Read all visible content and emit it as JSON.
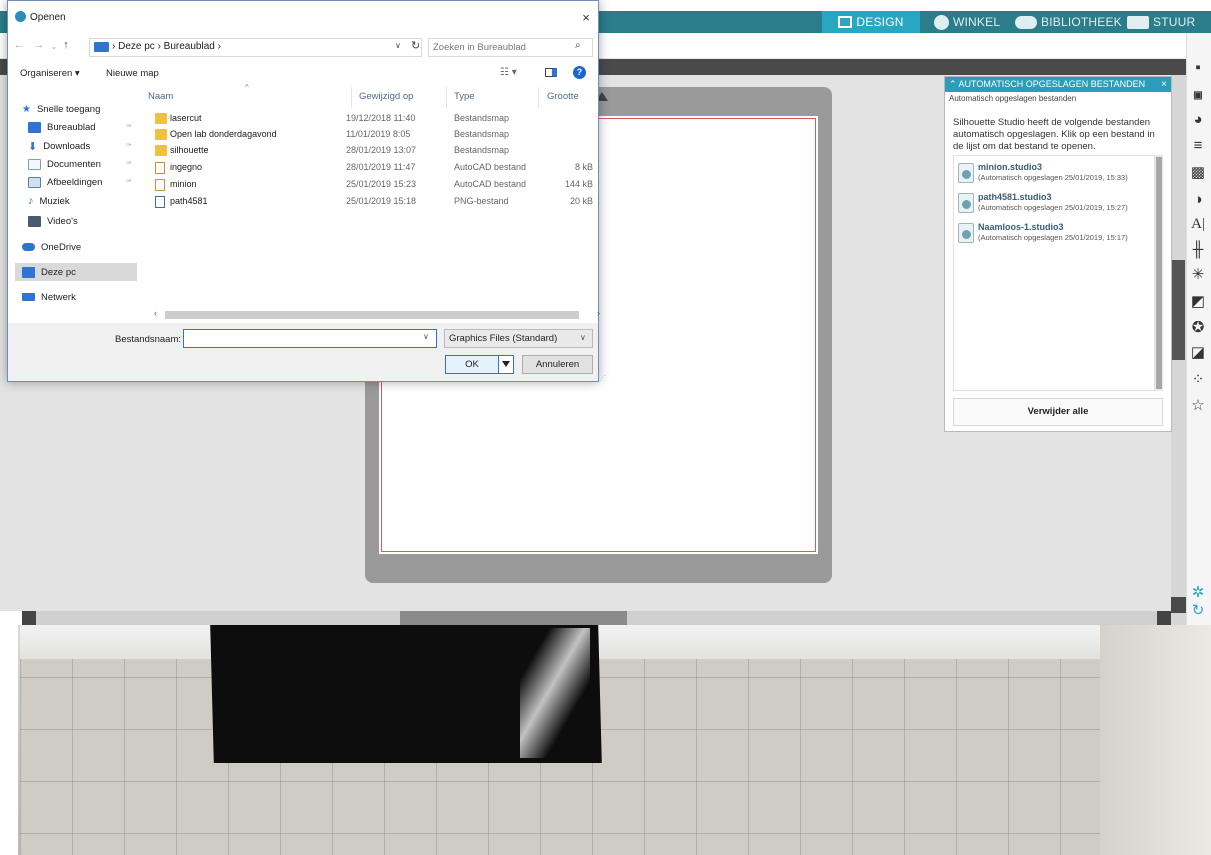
{
  "app": {
    "nav": [
      "DESIGN",
      "WINKEL",
      "BIBLIOTHEEK",
      "STUUR"
    ],
    "colors": {
      "topbar": "#2b7d8c",
      "active_tab": "#27a7c1",
      "cut_line": "#e25757"
    }
  },
  "autosave": {
    "header": "AUTOMATISCH OPGESLAGEN BESTANDEN",
    "close": "×",
    "subtitle": "Automatisch opgeslagen bestanden",
    "intro": "Silhouette Studio heeft de volgende bestanden automatisch opgeslagen. Klik op een bestand in de lijst om dat bestand te openen.",
    "files": [
      {
        "name": "minion.studio3",
        "meta": "(Automatisch opgeslagen 25/01/2019, 15:33)"
      },
      {
        "name": "path4581.studio3",
        "meta": "(Automatisch opgeslagen 25/01/2019, 15:27)"
      },
      {
        "name": "Naamloos-1.studio3",
        "meta": "(Automatisch opgeslagen 25/01/2019, 15:17)"
      }
    ],
    "delete_all": "Verwijder alle"
  },
  "dialog": {
    "title": "Openen",
    "close": "×",
    "breadcrumb": "› Deze pc › Bureaublad ›",
    "search_placeholder": "Zoeken in Bureaublad",
    "toolbar": {
      "organize": "Organiseren ▾",
      "new_folder": "Nieuwe map"
    },
    "nav_pane": [
      {
        "label": "Snelle toegang",
        "icon": "star-icon",
        "pinned": false
      },
      {
        "label": "Bureaublad",
        "icon": "desktop-icon",
        "pinned": true
      },
      {
        "label": "Downloads",
        "icon": "download-icon",
        "pinned": true
      },
      {
        "label": "Documenten",
        "icon": "documents-icon",
        "pinned": true
      },
      {
        "label": "Afbeeldingen",
        "icon": "pictures-icon",
        "pinned": true
      },
      {
        "label": "Muziek",
        "icon": "music-icon",
        "pinned": false
      },
      {
        "label": "Video's",
        "icon": "video-icon",
        "pinned": false
      },
      {
        "label": "OneDrive",
        "icon": "onedrive-icon",
        "pinned": false
      },
      {
        "label": "Deze pc",
        "icon": "this-pc-icon",
        "pinned": false,
        "selected": true
      },
      {
        "label": "Netwerk",
        "icon": "network-icon",
        "pinned": false
      }
    ],
    "columns": {
      "name": "Naam",
      "modified": "Gewijzigd op",
      "type": "Type",
      "size": "Grootte"
    },
    "files": [
      {
        "name": "lasercut",
        "modified": "19/12/2018 11:40",
        "type": "Bestandsmap",
        "size": "",
        "icon": "folder-icon"
      },
      {
        "name": "Open lab donderdagavond",
        "modified": "11/01/2019 8:05",
        "type": "Bestandsmap",
        "size": "",
        "icon": "folder-icon"
      },
      {
        "name": "silhouette",
        "modified": "28/01/2019 13:07",
        "type": "Bestandsmap",
        "size": "",
        "icon": "folder-icon"
      },
      {
        "name": "ingegno",
        "modified": "28/01/2019 11:47",
        "type": "AutoCAD bestand",
        "size": "8 kB",
        "icon": "autocad-file-icon"
      },
      {
        "name": "minion",
        "modified": "25/01/2019 15:23",
        "type": "AutoCAD bestand",
        "size": "144 kB",
        "icon": "autocad-file-icon"
      },
      {
        "name": "path4581",
        "modified": "25/01/2019 15:18",
        "type": "PNG-bestand",
        "size": "20 kB",
        "icon": "png-file-icon"
      }
    ],
    "filename_label": "Bestandsnaam:",
    "filename_value": "",
    "filetype": "Graphics Files (Standard)",
    "ok": "OK",
    "cancel": "Annuleren"
  }
}
